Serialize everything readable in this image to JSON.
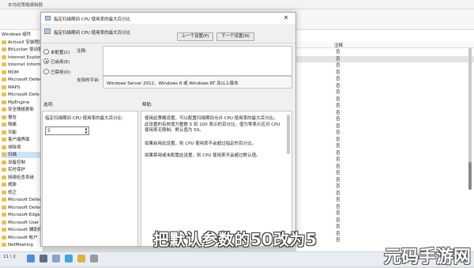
{
  "background_window": {
    "title": "本地组策略编辑器",
    "tree_items": [
      {
        "label": "Windows 组件",
        "folder": false,
        "selected": false
      },
      {
        "label": "ActiveX 安装程序服",
        "folder": true,
        "selected": false
      },
      {
        "label": "BitLocker 驱动器加",
        "folder": true,
        "selected": false
      },
      {
        "label": "Internet Explorer",
        "folder": true,
        "selected": false
      },
      {
        "label": "Internet Informatio",
        "folder": true,
        "selected": false
      },
      {
        "label": "MDM",
        "folder": true,
        "selected": false
      },
      {
        "label": "Microsoft Defende",
        "folder": true,
        "selected": false
      },
      {
        "label": "MAPS",
        "folder": true,
        "selected": false
      },
      {
        "label": "Microsoft Defe",
        "folder": true,
        "selected": false
      },
      {
        "label": "MpEngine",
        "folder": true,
        "selected": false
      },
      {
        "label": "安全情报更新",
        "folder": true,
        "selected": false
      },
      {
        "label": "报告",
        "folder": true,
        "selected": false
      },
      {
        "label": "隔离",
        "folder": true,
        "selected": false
      },
      {
        "label": "功能",
        "folder": true,
        "selected": false
      },
      {
        "label": "客户端界面",
        "folder": true,
        "selected": false
      },
      {
        "label": "排除项",
        "folder": true,
        "selected": false
      },
      {
        "label": "扫描",
        "folder": true,
        "selected": true
      },
      {
        "label": "设备控制",
        "folder": true,
        "selected": false
      },
      {
        "label": "实时保护",
        "folder": true,
        "selected": false
      },
      {
        "label": "网络检查系统",
        "folder": true,
        "selected": false
      },
      {
        "label": "威胁",
        "folder": true,
        "selected": false
      },
      {
        "label": "修正",
        "folder": true,
        "selected": false
      },
      {
        "label": "Microsoft Defend",
        "folder": true,
        "selected": false
      },
      {
        "label": "Microsoft Defend",
        "folder": true,
        "selected": false
      },
      {
        "label": "Microsoft Edge",
        "folder": true,
        "selected": false
      },
      {
        "label": "Microsoft User Ex",
        "folder": true,
        "selected": false
      },
      {
        "label": "Microsoft 辅助修",
        "folder": true,
        "selected": false
      },
      {
        "label": "Microsoft 帐户",
        "folder": true,
        "selected": false
      },
      {
        "label": "NetMeeting",
        "folder": true,
        "selected": false
      }
    ],
    "list_header": "注释",
    "list_rows": [
      "否",
      "否",
      "否",
      "否",
      "否",
      "否",
      "否",
      "否",
      "否",
      "否",
      "否",
      "否",
      "否",
      "否",
      "否",
      "否",
      "否",
      "否",
      "否",
      "否",
      "否",
      "否",
      "否",
      "否",
      "否",
      "否",
      "否",
      "否",
      "否"
    ]
  },
  "dialog": {
    "title": "指定扫描期间 CPU 使用率的最大百分比",
    "close_glyph": "✕",
    "header_title": "指定扫描期间 CPU 使用率的最大百分比",
    "prev_button": "上一个设置(P)",
    "next_button": "下一个设置(N)",
    "radio_not_configured": "未配置(C)",
    "radio_enabled": "已启用(E)",
    "radio_disabled": "已禁用(D)",
    "selected_state": "enabled",
    "comment_label": "注释:",
    "supported_label": "支持的平台:",
    "supported_value": "Windows Server 2012、Windows 8 或 Windows RT 及以上版本",
    "options_label": "选项:",
    "help_label": "帮助:",
    "option_description": "指定扫描期间 CPU 使用率的最大百分比:",
    "cpu_percent_value": "5",
    "help_paragraphs": [
      "使用此策略设置，可以配置扫描期间允许 CPU 使用率的最大百分比。此设置的有效值为整数 5 到 100 表示的百分比。值为零表示应对 CPU 使用率无限制。默认值为 50。",
      "如果启用此设置，则 CPU 使用率不会超过指定的百分比。",
      "如果禁用或未配置此设置，则 CPU 使用率不会超过默认值。"
    ]
  },
  "taskbar": {
    "time": "11 \\ 2"
  },
  "overlay": {
    "subtitle": "把默认参数的50改为5",
    "watermark": "元码手游网"
  }
}
